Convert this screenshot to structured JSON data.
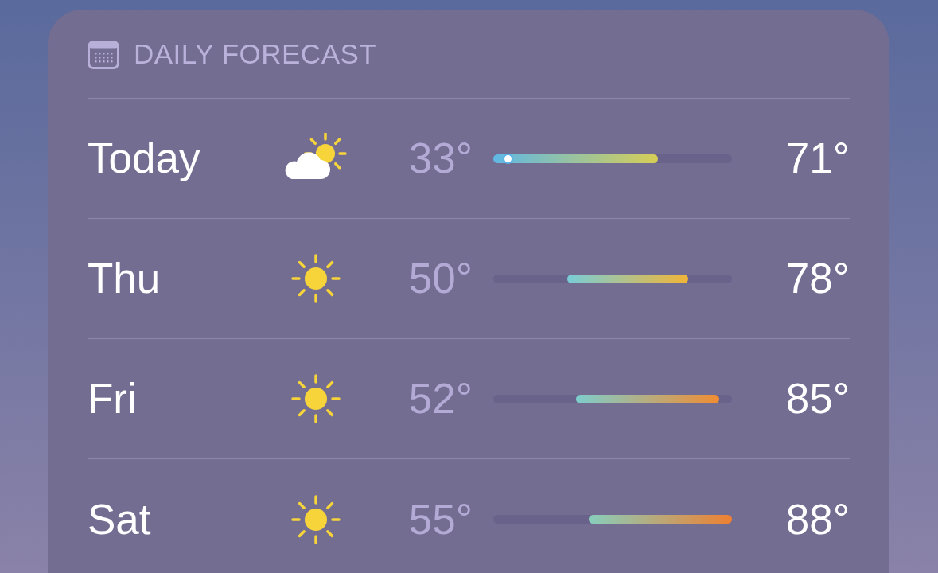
{
  "header": {
    "title": "DAILY FORECAST"
  },
  "days": [
    {
      "day": "Today",
      "kind": "partly_cloudy",
      "low": "33°",
      "high": "71°",
      "current": {
        "level": 0.06
      }
    },
    {
      "day": "Thu",
      "kind": "sun",
      "low": "50°",
      "high": "78°"
    },
    {
      "day": "Fri",
      "kind": "sun",
      "low": "52°",
      "high": "85°"
    },
    {
      "day": "Sat",
      "kind": "sun",
      "low": "55°",
      "high": "88°"
    }
  ]
}
